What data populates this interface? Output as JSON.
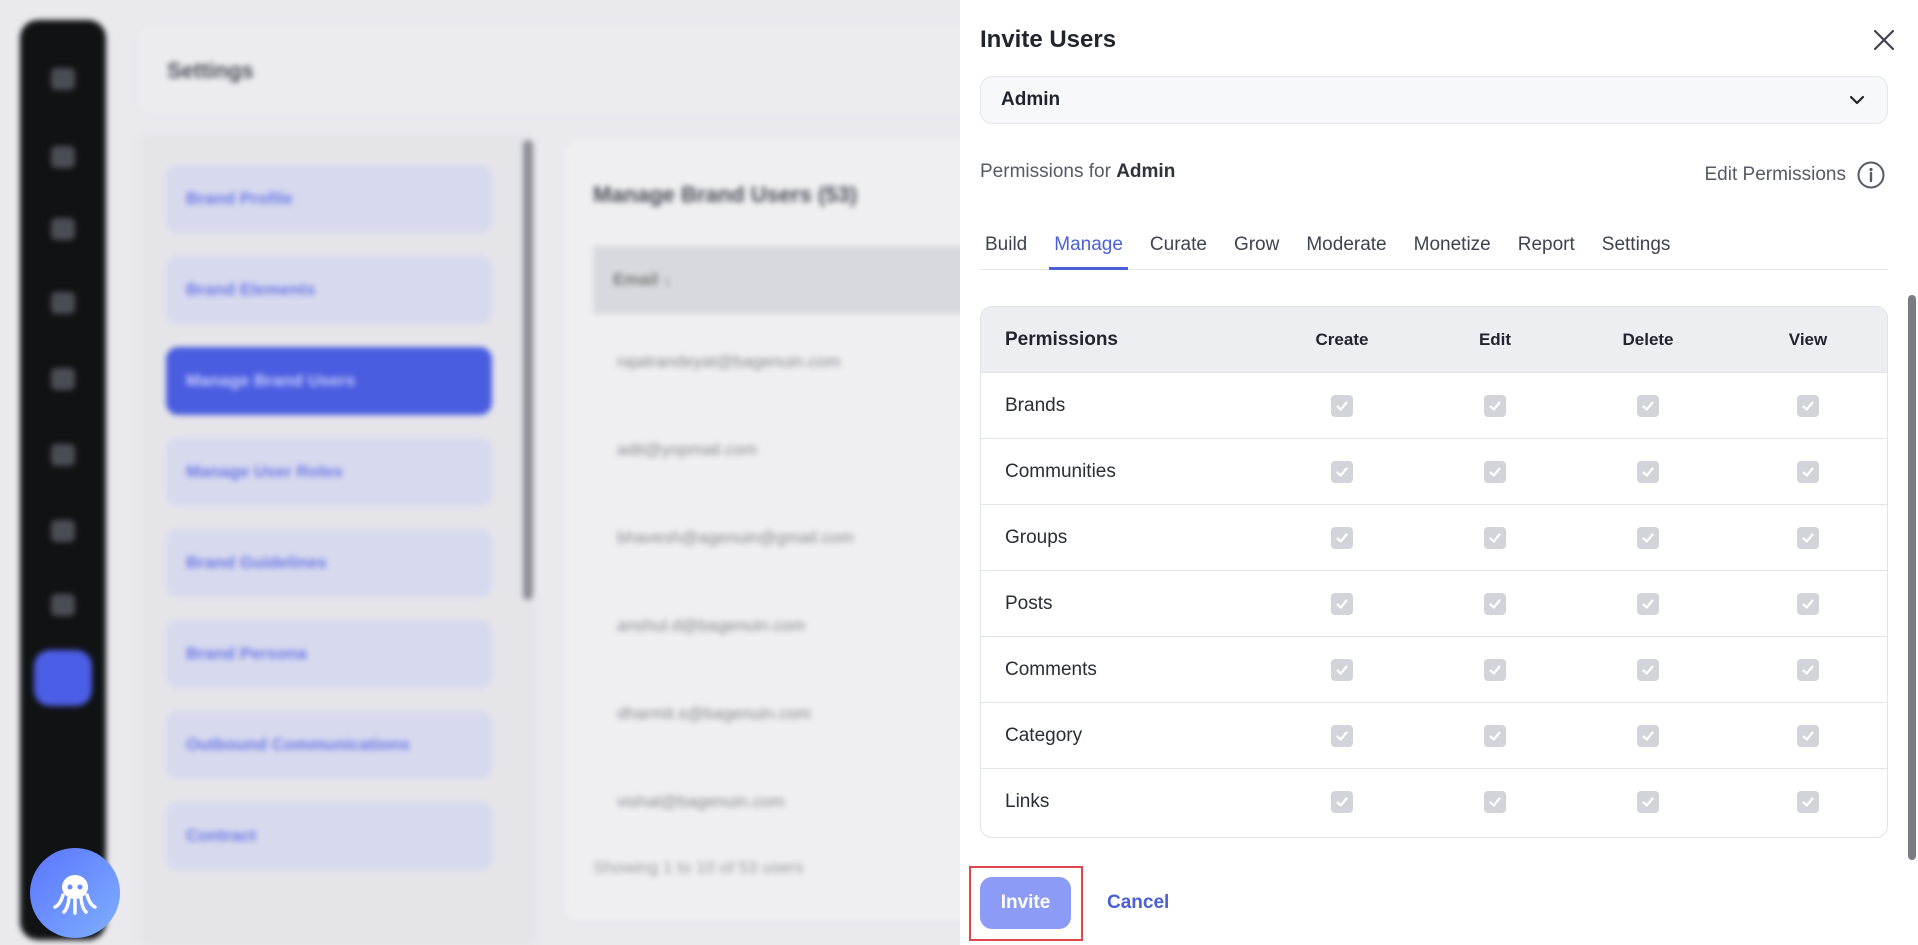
{
  "background": {
    "header_title": "Settings",
    "sidebar_items": [
      {
        "label": "Brand Profile",
        "active": false
      },
      {
        "label": "Brand Elements",
        "active": false
      },
      {
        "label": "Manage Brand Users",
        "active": true
      },
      {
        "label": "Manage User Roles",
        "active": false
      },
      {
        "label": "Brand Guidelines",
        "active": false
      },
      {
        "label": "Brand Persona",
        "active": false
      },
      {
        "label": "Outbound Communications",
        "active": false
      },
      {
        "label": "Contract",
        "active": false
      }
    ],
    "main_title": "Manage Brand Users (53)",
    "table_header": "Email ↓",
    "emails": [
      "rajatrandeyat@bagenuin.com",
      "adit@yopmail.com",
      "bhavesh@agenuin@gmail.com",
      "anshul.d@bagenuin.com",
      "dharmit.s@bagenuin.com",
      "vishal@bagenuin.com"
    ],
    "footer_text": "Showing 1 to 10 of 53 users"
  },
  "drawer": {
    "title": "Invite Users",
    "role_select": {
      "value": "Admin"
    },
    "permissions_for_label": "Permissions for",
    "permissions_for_role": "Admin",
    "edit_permissions_label": "Edit Permissions",
    "tabs": [
      {
        "label": "Build",
        "active": false
      },
      {
        "label": "Manage",
        "active": true
      },
      {
        "label": "Curate",
        "active": false
      },
      {
        "label": "Grow",
        "active": false
      },
      {
        "label": "Moderate",
        "active": false
      },
      {
        "label": "Monetize",
        "active": false
      },
      {
        "label": "Report",
        "active": false
      },
      {
        "label": "Settings",
        "active": false
      }
    ],
    "table": {
      "columns": [
        "Permissions",
        "Create",
        "Edit",
        "Delete",
        "View"
      ],
      "rows": [
        {
          "name": "Brands",
          "values": [
            true,
            true,
            true,
            true
          ]
        },
        {
          "name": "Communities",
          "values": [
            true,
            true,
            true,
            true
          ]
        },
        {
          "name": "Groups",
          "values": [
            true,
            true,
            true,
            true
          ]
        },
        {
          "name": "Posts",
          "values": [
            true,
            true,
            true,
            true
          ]
        },
        {
          "name": "Comments",
          "values": [
            true,
            true,
            true,
            true
          ]
        },
        {
          "name": "Category",
          "values": [
            true,
            true,
            true,
            true
          ]
        },
        {
          "name": "Links",
          "values": [
            true,
            true,
            true,
            true
          ]
        }
      ]
    },
    "invite_label": "Invite",
    "cancel_label": "Cancel"
  },
  "colors": {
    "accent": "#4b5fd6",
    "invite_button": "#8c9cf6",
    "highlight_border": "#e0464d",
    "checkbox_disabled": "#d2d4d9"
  },
  "icons": {
    "close": "close-icon",
    "dropdown": "chevron-down-icon",
    "info": "info-icon",
    "checkbox": "checkbox-checked-icon",
    "assistant": "octopus-icon"
  }
}
